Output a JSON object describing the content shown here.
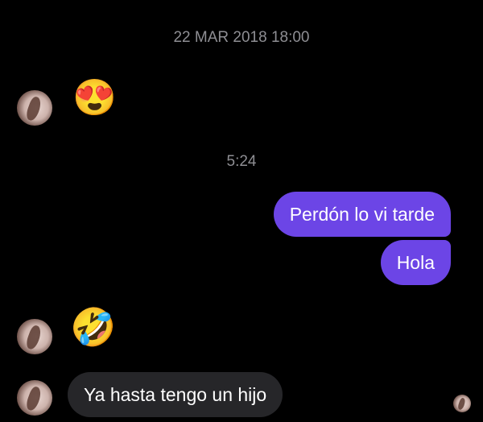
{
  "conversation": {
    "timestamps": [
      "22 MAR 2018 18:00",
      "5:24"
    ],
    "messages": [
      {
        "direction": "received",
        "type": "emoji",
        "emoji": "😍",
        "icon": "heart-eyes-emoji"
      },
      {
        "direction": "sent",
        "type": "text",
        "text": "Perdón lo vi tarde"
      },
      {
        "direction": "sent",
        "type": "text",
        "text": "Hola"
      },
      {
        "direction": "received",
        "type": "emoji",
        "emoji": "🤣",
        "icon": "rofl-emoji"
      },
      {
        "direction": "received",
        "type": "text",
        "text": "Ya hasta tengo un hijo"
      }
    ]
  },
  "colors": {
    "background": "#000000",
    "sent_bubble": "#6c45e6",
    "received_bubble": "#262629",
    "timestamp_text": "#8e8e93"
  }
}
